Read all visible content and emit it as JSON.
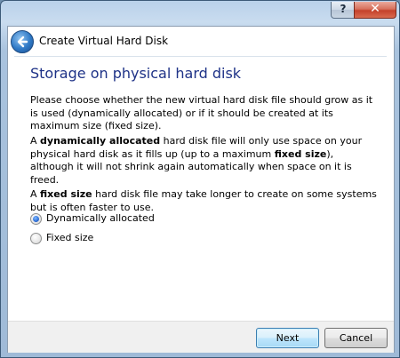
{
  "window": {
    "help_label": "?",
    "close_label": "✕"
  },
  "dialog": {
    "title": "Create Virtual Hard Disk"
  },
  "page": {
    "heading": "Storage on physical hard disk",
    "intro": "Please choose whether the new virtual hard disk file should grow as it is used (dynamically allocated) or if it should be created at its maximum size (fixed size).",
    "dynamic_para": {
      "a": "A ",
      "term": "dynamically allocated",
      "b": " hard disk file will only use space on your physical hard disk as it fills up (up to a maximum ",
      "term2": "fixed size",
      "c": "), although it will not shrink again automatically when space on it is freed."
    },
    "fixed_para": {
      "a": "A ",
      "term": "fixed size",
      "b": " hard disk file may take longer to create on some systems but is often faster to use."
    },
    "options": [
      {
        "label": "Dynamically allocated",
        "selected": true
      },
      {
        "label": "Fixed size",
        "selected": false
      }
    ]
  },
  "footer": {
    "next_label": "Next",
    "cancel_label": "Cancel"
  }
}
